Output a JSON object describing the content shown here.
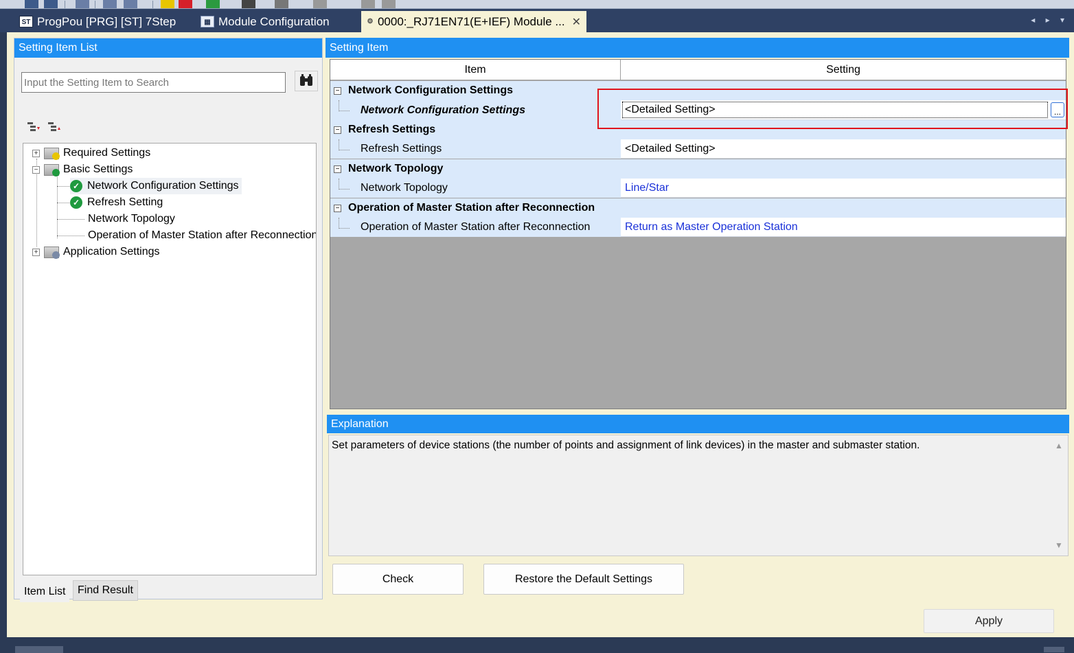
{
  "tabs": [
    {
      "icon": "ST",
      "label": "ProgPou [PRG] [ST] 7Step"
    },
    {
      "icon": "▦",
      "label": "Module Configuration"
    },
    {
      "icon": "⚙",
      "label": "0000:_RJ71EN71(E+IEF) Module ...",
      "close": "✕",
      "active": true
    }
  ],
  "left_panel": {
    "header": "Setting Item List",
    "search_placeholder": "Input the Setting Item to Search",
    "tree": {
      "required": "Required Settings",
      "basic": "Basic Settings",
      "network_config": "Network Configuration Settings",
      "refresh": "Refresh Setting",
      "topology": "Network Topology",
      "reconnect": "Operation of Master Station after Reconnection",
      "application": "Application Settings"
    },
    "bottom_tabs": {
      "item_list": "Item List",
      "find_result": "Find Result"
    }
  },
  "right_panel": {
    "header": "Setting Item",
    "columns": {
      "item": "Item",
      "setting": "Setting"
    },
    "rows": {
      "g1": "Network Configuration Settings",
      "s1": "Network Configuration Settings",
      "v1": "<Detailed Setting>",
      "g2": "Refresh Settings",
      "s2": "Refresh Settings",
      "v2": "<Detailed Setting>",
      "g3": "Network Topology",
      "s3": "Network Topology",
      "v3": "Line/Star",
      "g4": "Operation of Master Station after Reconnection",
      "s4": "Operation of Master Station after Reconnection",
      "v4": "Return as Master Operation Station"
    },
    "dots_label": "...",
    "explanation_header": "Explanation",
    "explanation_text": "Set parameters of device stations (the number of points and assignment of link devices) in the master and submaster station."
  },
  "buttons": {
    "check": "Check",
    "restore": "Restore the Default Settings",
    "apply": "Apply"
  },
  "colors": {
    "header_blue": "#1f90f2",
    "selected_cell_highlight": "#e0141c",
    "check_green": "#1f9a3f",
    "value_blue": "#1930d8"
  }
}
